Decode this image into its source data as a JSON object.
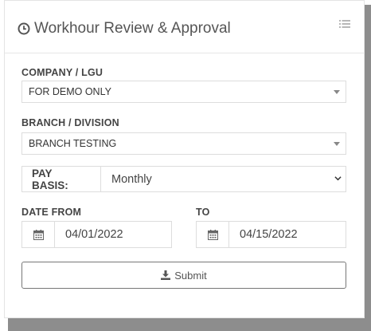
{
  "panel": {
    "title": "Workhour Review & Approval",
    "title_icon": "clock-icon",
    "menu_icon": "list-icon"
  },
  "form": {
    "company": {
      "label": "COMPANY / LGU",
      "value": "FOR DEMO ONLY"
    },
    "branch": {
      "label": "BRANCH / DIVISION",
      "value": "BRANCH TESTING"
    },
    "pay_basis": {
      "label": "PAY BASIS:",
      "value": "Monthly"
    },
    "date_from": {
      "label": "DATE FROM",
      "value": "04/01/2022",
      "icon": "calendar-icon"
    },
    "date_to": {
      "label": "TO",
      "value": "04/15/2022",
      "icon": "calendar-icon"
    },
    "submit_label": "Submit",
    "submit_icon": "download-icon"
  }
}
